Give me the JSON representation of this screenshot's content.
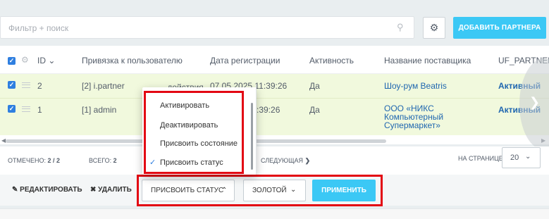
{
  "filter": {
    "placeholder": "Фильтр + поиск",
    "search_icon": "search-icon"
  },
  "toolbar": {
    "settings_icon": "gear-icon",
    "add_partner_label": "ДОБАВИТЬ ПАРТНЕРА"
  },
  "grid": {
    "columns": [
      "ID",
      "Привязка к пользователю",
      "Дата регистрации",
      "Активность",
      "Название поставщика",
      "UF_PARTNEF"
    ],
    "rows": [
      {
        "id": "2",
        "user": "[2] i.partner",
        "action": "- действия -",
        "date": "07.05.2025 11:39:26",
        "active": "Да",
        "supplier": "Шоу-рум Beatris",
        "status": "Активный"
      },
      {
        "id": "1",
        "user": "[1] admin",
        "date": ":39:26",
        "active": "Да",
        "supplier_line1": "ООО «НИКС",
        "supplier_line2": "Компьютерный",
        "supplier_line3": "Супермаркет»",
        "status": "Активный"
      }
    ]
  },
  "footer": {
    "selected_label": "ОТМЕЧЕНО: ",
    "selected_value": "2 / 2",
    "total_label": "ВСЕГО: ",
    "total_value": "2",
    "next_label": "СЛЕДУЮЩАЯ",
    "per_page_label": "НА СТРАНИЦЕ:",
    "per_page_value": "20"
  },
  "actions": {
    "edit_label": "РЕДАКТИРОВАТЬ",
    "delete_label": "УДАЛИТЬ",
    "action_select": "ПРИСВОИТЬ СТАТУС",
    "status_select": "ЗОЛОТОЙ",
    "apply_label": "ПРИМЕНИТЬ"
  },
  "popup": {
    "items": [
      "Активировать",
      "Деактивировать",
      "Присвоить состояние",
      "Присвоить статус"
    ],
    "selected_index": 3
  },
  "colors": {
    "accent": "#3bc8f5",
    "highlight": "#e30613",
    "row_selected": "#f1f9dd",
    "link": "#2067b0"
  }
}
